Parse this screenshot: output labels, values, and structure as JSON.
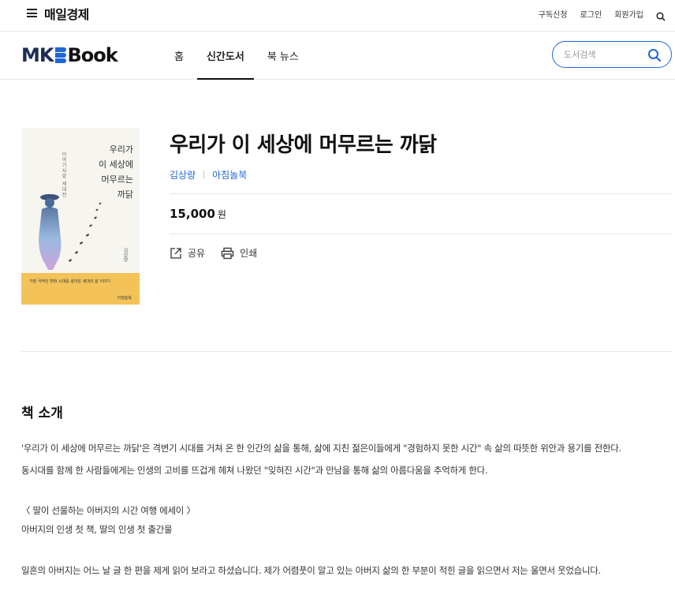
{
  "topbar": {
    "brand": "매일경제",
    "links": [
      "구독신청",
      "로그인",
      "회원가입"
    ]
  },
  "nav": {
    "logo_mk": "MK",
    "logo_book": "Book",
    "tabs": [
      {
        "label": "홈",
        "active": false
      },
      {
        "label": "신간도서",
        "active": true
      },
      {
        "label": "북 뉴스",
        "active": false
      }
    ],
    "search_placeholder": "도서검색"
  },
  "book": {
    "title": "우리가 이 세상에 머무르는 까닭",
    "author": "김상량",
    "publisher": "아침놀북",
    "price": "15,000",
    "price_unit": "원",
    "share_label": "공유",
    "print_label": "인쇄",
    "cover": {
      "title_lines": [
        "우리가",
        "이 세상에",
        "머무르는",
        "까닭"
      ],
      "series": "이야기사랑 세대전",
      "band_text": "가장 극적인 변화 시대를 살아온 세대의 삶 이야기"
    }
  },
  "intro": {
    "heading": "책 소개",
    "paragraphs": [
      "'우리가 이 세상에 머무르는 까닭'은 격변기 시대를 거쳐 온 한 인간의 삶을 통해, 삶에 지친 젊은이들에게 \"경험하지 못한 시간\" 속 삶의 따뜻한 위안과 용기를 전한다.",
      "동시대를 함께 한 사람들에게는 인생의 고비를 뜨겁게 헤쳐 나왔던 \"잊혀진 시간\"과 만남을 통해 삶의 아름다움을 추억하게 한다.",
      "〈 딸이 선물하는 아버지의 시간 여행 에세이 〉",
      "아버지의 인생 첫 책, 딸의 인생 첫 출간물",
      "일흔의 아버지는 어느 날 글 한 편을 제게 읽어 보라고 하셨습니다. 제가 어렴풋이 알고 있는 아버지 삶의 한 부분이 적힌 글을 읽으면서 저는 울면서 웃었습니다."
    ]
  },
  "colors": {
    "accent": "#1f67d9",
    "logo_navy": "#1c2c55",
    "cover_band": "#f3c35a"
  }
}
